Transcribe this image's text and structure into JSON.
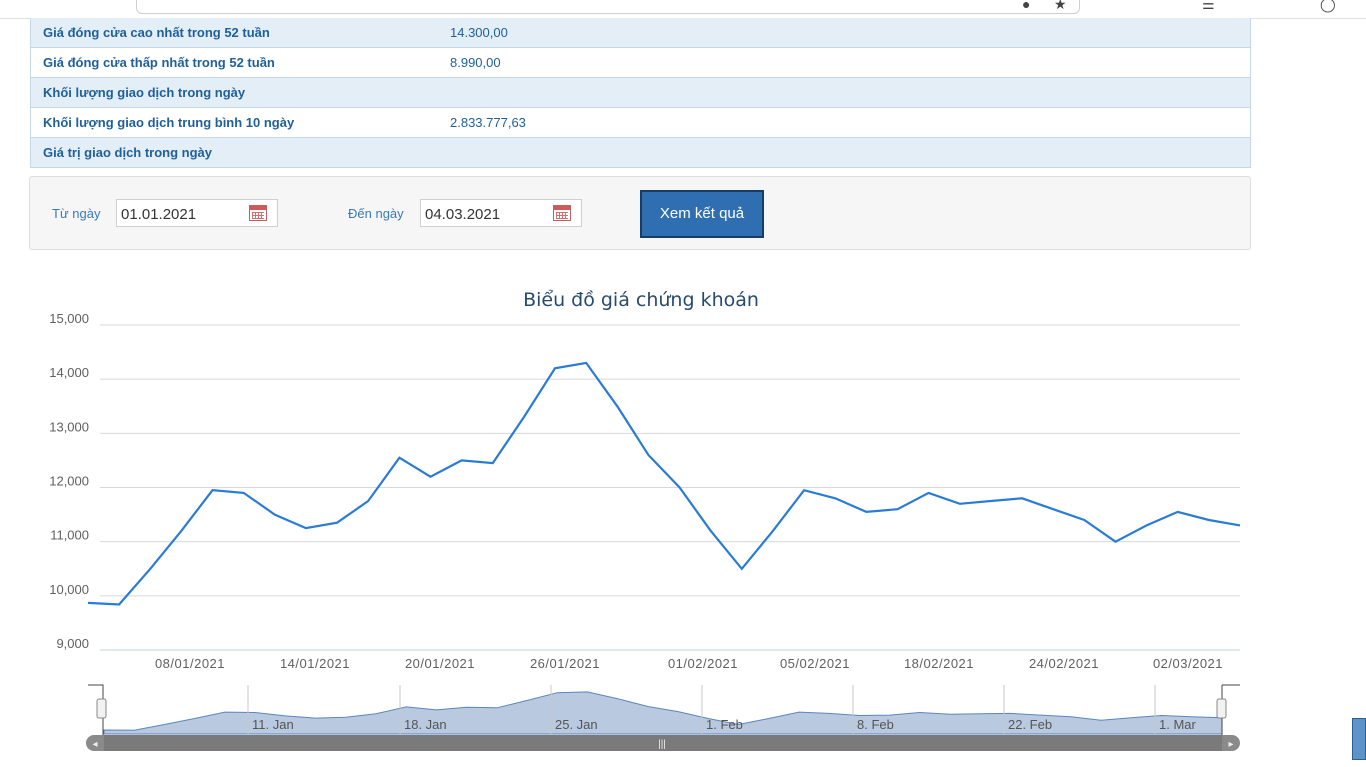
{
  "info_rows": [
    {
      "label": "Giá đóng cửa cao nhất trong 52 tuần",
      "value": "14.300,00"
    },
    {
      "label": "Giá đóng cửa thấp nhất trong 52 tuần",
      "value": "8.990,00"
    },
    {
      "label": "Khối lượng giao dịch trong ngày",
      "value": ""
    },
    {
      "label": "Khối lượng giao dịch trung bình 10 ngày",
      "value": "2.833.777,63"
    },
    {
      "label": "Giá trị giao dịch trong ngày",
      "value": ""
    }
  ],
  "filter": {
    "from_label": "Từ ngày",
    "from_value": "01.01.2021",
    "to_label": "Đến ngày",
    "to_value": "04.03.2021",
    "submit_label": "Xem kết quả"
  },
  "colors": {
    "line": "#2a7bd6",
    "nav_fill": "#b9c9df",
    "header_blue": "#1e5f9c"
  },
  "chart_data": {
    "type": "line",
    "title": "Biểu đồ giá chứng khoán",
    "ylim": [
      9000,
      15000
    ],
    "yticks": [
      "15,000",
      "14,000",
      "13,000",
      "12,000",
      "11,000",
      "10,000",
      "9,000"
    ],
    "ytick_values": [
      15000,
      14000,
      13000,
      12000,
      11000,
      10000,
      9000
    ],
    "xticks": [
      "08/01/2021",
      "14/01/2021",
      "20/01/2021",
      "26/01/2021",
      "01/02/2021",
      "05/02/2021",
      "18/02/2021",
      "24/02/2021",
      "02/03/2021"
    ],
    "grid": true,
    "navigator_labels": [
      "11. Jan",
      "18. Jan",
      "25. Jan",
      "1. Feb",
      "8. Feb",
      "22. Feb",
      "1. Mar"
    ],
    "series": [
      {
        "values": [
          9870,
          9840,
          10500,
          11200,
          11950,
          11900,
          11500,
          11250,
          11350,
          11750,
          12550,
          12200,
          12500,
          12450,
          13300,
          14200,
          14300,
          13500,
          12600,
          12000,
          11200,
          10500,
          11200,
          11950,
          11800,
          11550,
          11600,
          11900,
          11700,
          11750,
          11800,
          11600,
          11400,
          11000,
          11300,
          11550,
          11400,
          11300
        ]
      }
    ]
  }
}
